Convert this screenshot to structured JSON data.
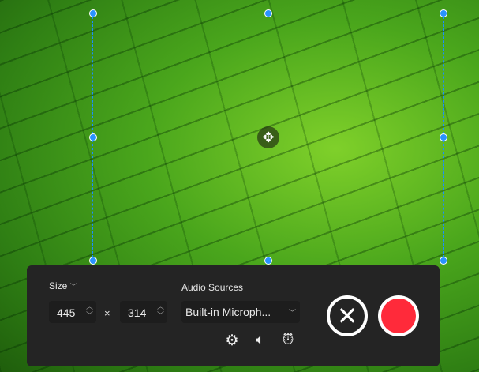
{
  "size": {
    "label": "Size",
    "width": "445",
    "height": "314",
    "times": "×"
  },
  "audio": {
    "label": "Audio Sources",
    "selected": "Built-in Microph..."
  },
  "colors": {
    "record": "#ff2a3a",
    "selection": "#1a8fff",
    "panel": "#242424"
  }
}
